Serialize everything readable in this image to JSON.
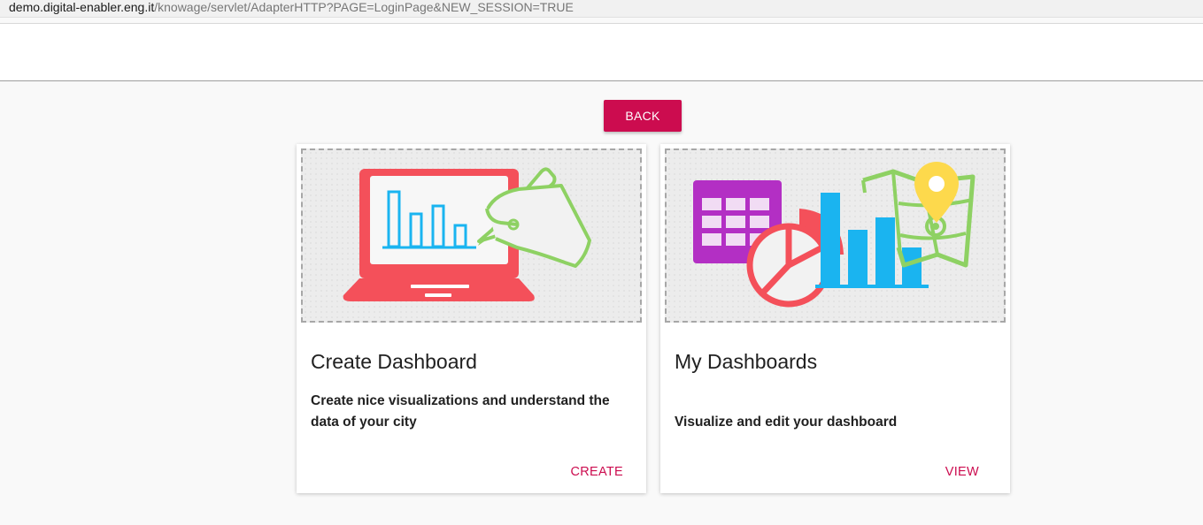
{
  "browser": {
    "url_host": "demo.digital-enabler.eng.it",
    "url_path": "/knowage/servlet/AdapterHTTP?PAGE=LoginPage&NEW_SESSION=TRUE"
  },
  "back_label": "BACK",
  "cards": [
    {
      "title": "Create Dashboard",
      "description": "Create nice visualizations and understand the data of your city",
      "action": "CREATE"
    },
    {
      "title": "My Dashboards",
      "description": "Visualize and edit your dashboard",
      "action": "VIEW"
    }
  ],
  "colors": {
    "accent": "#cc0c4f",
    "laptop": "#f4505a",
    "chart_blue": "#1ab4f0",
    "hand_green": "#8ed163",
    "table_purple": "#b32fc4",
    "pin_yellow": "#fdd94c"
  }
}
